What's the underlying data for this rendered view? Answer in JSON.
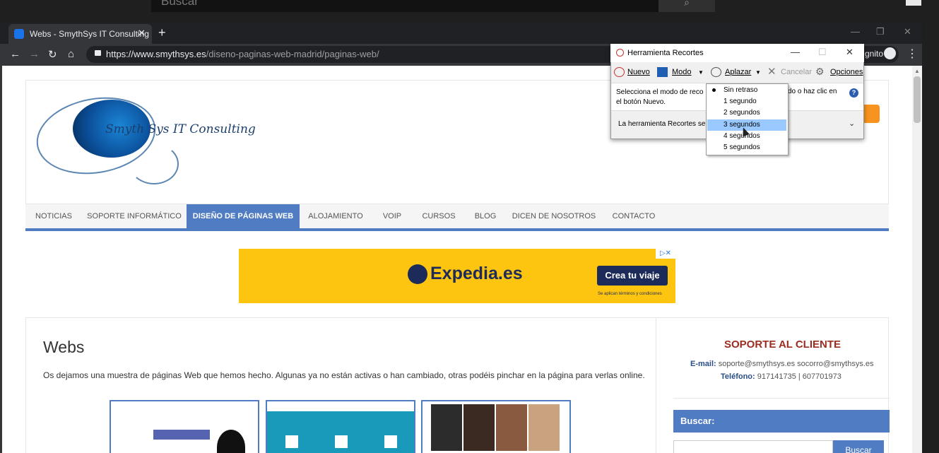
{
  "top_search": {
    "placeholder": "Buscar",
    "button_icon": "search-icon"
  },
  "browser": {
    "tab_title": "Webs - SmythSys IT Consulting",
    "tab_close": "✕",
    "new_tab": "+",
    "url_host": "https://www.smythsys.es",
    "url_path": "/diseno-paginas-web-madrid/paginas-web/",
    "incognito_label": "gnito"
  },
  "site": {
    "logo_text": "Smyth Sys IT Consulting",
    "nav": [
      "NOTICIAS",
      "SOPORTE INFORMÁTICO",
      "DISEÑO DE PÁGINAS WEB",
      "ALOJAMIENTO",
      "VOIP",
      "CURSOS",
      "BLOG",
      "DICEN DE NOSOTROS",
      "CONTACTO"
    ],
    "nav_active_index": 2,
    "ad": {
      "brand": "Expedia.es",
      "cta": "Crea tu viaje",
      "fine_print": "Se aplican términos y condiciones"
    },
    "page_title": "Webs",
    "intro": "Os dejamos una muestra de páginas Web que hemos hecho. Algunas ya no están activas o han cambiado, otras podéis pinchar en la página para verlas online.",
    "sidebar": {
      "support_title": "SOPORTE AL CLIENTE",
      "email_label": "E-mail:",
      "email_value": "soporte@smythsys.es socorro@smythsys.es",
      "phone_label": "Teléfono:",
      "phone_value": "917141735 | 607701973",
      "search_title": "Buscar:",
      "search_button": "Buscar"
    }
  },
  "snipping_tool": {
    "title": "Herramienta Recortes",
    "toolbar": {
      "new": "Nuevo",
      "mode": "Modo",
      "delay": "Aplazar",
      "cancel": "Cancelar",
      "options": "Opciones"
    },
    "message_line1": "Selecciona el modo de reco",
    "message_line1_end": "do o haz clic en",
    "message_line2": "el botón Nuevo.",
    "info": "La herramienta Recortes se",
    "delay_options": [
      "Sin retraso",
      "1 segundo",
      "2 segundos",
      "3 segundos",
      "4 segundos",
      "5 segundos"
    ],
    "delay_highlighted_index": 3,
    "delay_checked_index": 0
  },
  "colors": {
    "accent": "#4f7cc2",
    "support_title": "#9b2d20",
    "ad_bg": "#fdc50f",
    "dropdown_highlight": "#99c9ff"
  }
}
